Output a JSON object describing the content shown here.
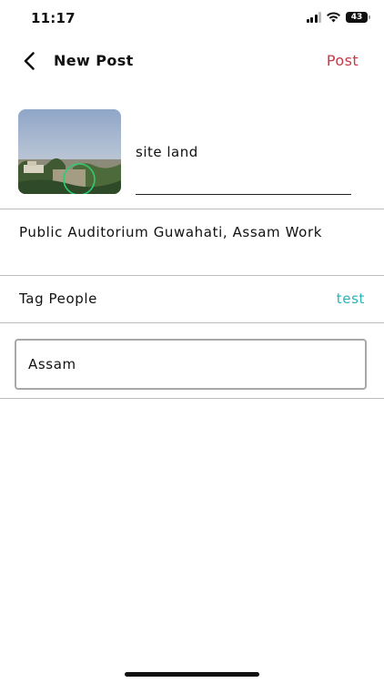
{
  "status_bar": {
    "time": "11:17",
    "battery": "43",
    "icons": [
      "signal-icon",
      "wifi-icon",
      "battery-icon"
    ]
  },
  "nav": {
    "back_icon": "chevron-left-icon",
    "title": "New Post",
    "post_label": "Post",
    "post_color": "#c23b47"
  },
  "post": {
    "caption": "site land",
    "location": "Public Auditorium Guwahati, Assam Work",
    "tag_label": "Tag People",
    "tag_value": "test",
    "tag_color": "#27b3ba",
    "region_field": "Assam"
  }
}
